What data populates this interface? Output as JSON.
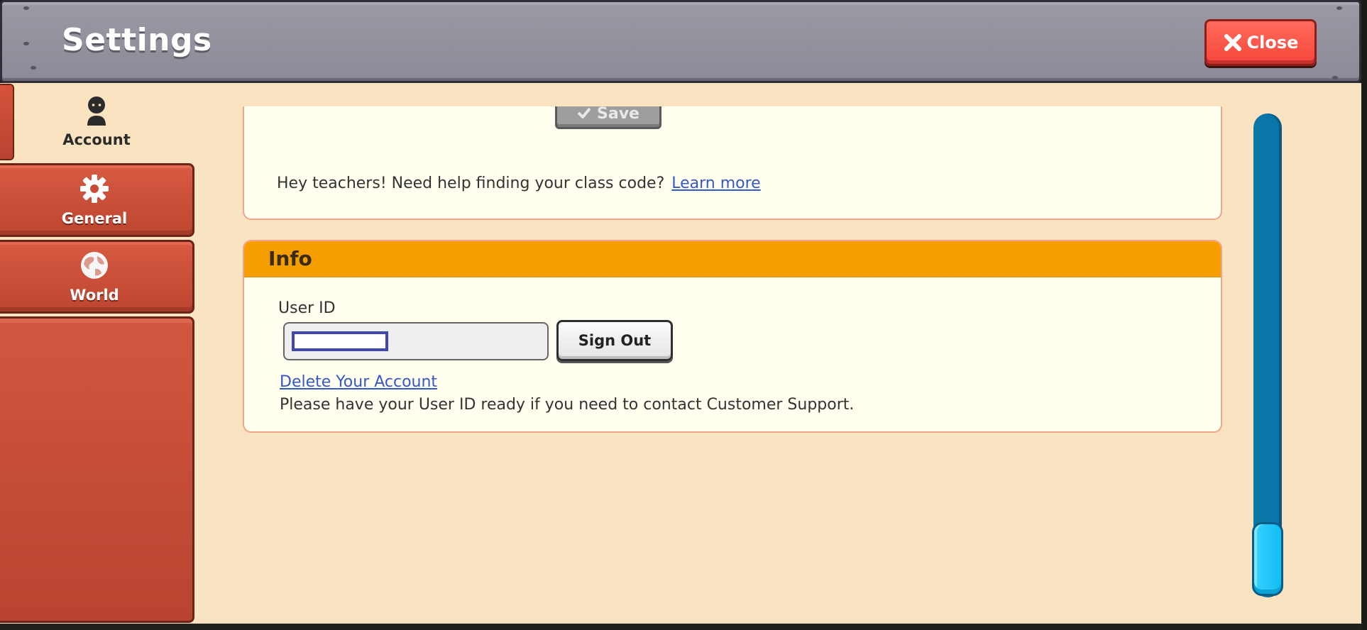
{
  "header": {
    "title": "Settings",
    "close_label": "Close"
  },
  "sidebar": {
    "tabs": [
      {
        "label": "Account",
        "icon": "person-icon",
        "active": true
      },
      {
        "label": "General",
        "icon": "gear-icon",
        "active": false
      },
      {
        "label": "World",
        "icon": "globe-icon",
        "active": false
      }
    ]
  },
  "class_section": {
    "save_label": "Save",
    "teachers_text": "Hey teachers! Need help finding your class code?",
    "learn_more_label": "Learn more"
  },
  "info_section": {
    "title": "Info",
    "user_id_label": "User ID",
    "user_id_value": "",
    "sign_out_label": "Sign Out",
    "delete_account_label": "Delete Your Account",
    "support_text": "Please have your User ID ready if you need to contact Customer Support."
  },
  "scrollbar": {
    "position": 1.0
  },
  "colors": {
    "header_bg": "#9b99a4",
    "close_red": "#f4473a",
    "tab_red": "#c64c36",
    "panel_bg": "#fae3c0",
    "info_orange": "#f49e00",
    "link_blue": "#3558c9",
    "scroll_blue": "#0a76a8",
    "thumb_cyan": "#22c7fb"
  }
}
